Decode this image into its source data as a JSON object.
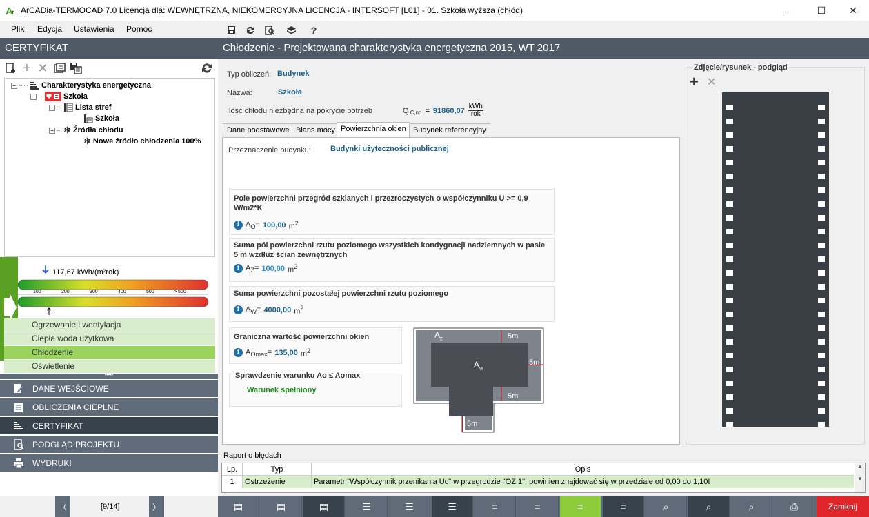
{
  "window": {
    "title": "ArCADia-TERMOCAD 7.0 Licencja dla: WEWNĘTRZNA, NIEKOMERCYJNA LICENCJA - INTERSOFT [L01] - 01. Szkoła wyższa (chłód)",
    "minimize": "—",
    "maximize": "☐",
    "close": "✕"
  },
  "menu": {
    "items": [
      {
        "label": "Plik"
      },
      {
        "label": "Edycja"
      },
      {
        "label": "Ustawienia"
      },
      {
        "label": "Pomoc"
      }
    ],
    "toolbar_icons": [
      "save-icon",
      "refresh-icon",
      "preview-icon",
      "layers-icon",
      "help-icon"
    ]
  },
  "left": {
    "header": "CERTYFIKAT",
    "tree": {
      "root": "Charakterystyka energetyczna",
      "building": "Szkoła",
      "zones": "Lista stref",
      "zone_item": "Szkoła",
      "sources": "Źródła chłodu",
      "source_item": "Nowe źródło chłodzenia 100%"
    },
    "energy": {
      "value_label": "117,67 kWh/(m²rok)",
      "ticks": [
        "100",
        "200",
        "300",
        "400",
        "500",
        "> 500"
      ]
    },
    "nav": [
      {
        "label": "Ogrzewanie i wentylacja"
      },
      {
        "label": "Ciepła woda użytkowa"
      },
      {
        "label": "Chłodzenie"
      },
      {
        "label": "Oświetlenie"
      }
    ],
    "dots": "•••••",
    "sections": [
      {
        "label": "DANE WEJŚCIOWE"
      },
      {
        "label": "OBLICZENIA CIEPLNE"
      },
      {
        "label": "CERTYFIKAT"
      },
      {
        "label": "PODGLĄD PROJEKTU"
      },
      {
        "label": "WYDRUKI"
      }
    ],
    "pager": {
      "text": "[9/14]",
      "prev": "〈",
      "next": "〉"
    }
  },
  "main": {
    "header": "Chłodzenie - Projektowana charakterystyka energetyczna 2015, WT 2017",
    "typ_label": "Typ obliczeń:",
    "typ_value": "Budynek",
    "nazwa_label": "Nazwa:",
    "nazwa_value": "Szkoła",
    "ilosc_label": "Ilość chłodu niezbędna na pokrycie potrzeb",
    "q_symbol": "Q",
    "q_sub": "C,nd",
    "q_eq": "=",
    "q_value": "91860,07",
    "q_unit_num": "kWh",
    "q_unit_den": "rok",
    "tabs": [
      {
        "label": "Dane podstawowe"
      },
      {
        "label": "Blans mocy"
      },
      {
        "label": "Powierzchnia okien"
      },
      {
        "label": "Budynek referencyjny"
      }
    ],
    "przeznaczenie_label": "Przeznaczenie budynku:",
    "przeznaczenie_value": "Budynki użyteczności publicznej",
    "box1": {
      "title": "Pole powierzchni przegród szklanych i przezroczystych o współczynniku U >= 0,9 W/m2*K",
      "sym": "A",
      "sub": "O",
      "value": "100,00",
      "unit": "m"
    },
    "box2": {
      "title": "Suma pól powierzchni rzutu poziomego wszystkich kondygnacji nadziemnych w pasie 5 m wzdłuż ścian zewnętrznych",
      "sym": "A",
      "sub": "Z",
      "value": "100,00",
      "unit": "m"
    },
    "box3": {
      "title": "Suma powierzchni pozostałej powierzchni rzutu poziomego",
      "sym": "A",
      "sub": "W",
      "value": "4000,00",
      "unit": "m"
    },
    "box4": {
      "title": "Graniczna wartość powierzchni okien",
      "sym": "A",
      "sub": "Omax",
      "value": "135,00",
      "unit": "m"
    },
    "box5": {
      "title": "Sprawdzenie warunku Ao ≤ Aomax",
      "result": "Warunek spełniony"
    },
    "diagram": {
      "az": "A",
      "az_sub": "z",
      "aw": "A",
      "aw_sub": "w",
      "d1": "5m",
      "d2": "5m",
      "d3": "5m",
      "d4": "5m"
    },
    "photo_title": "Zdjęcie/rysunek - podgląd",
    "report": {
      "title": "Raport o błędach",
      "headers": [
        "Lp.",
        "Typ",
        "Opis"
      ],
      "rows": [
        {
          "lp": "1",
          "typ": "Ostrzeżenie",
          "opis": "Parametr \"Współczynnik przenikania Uc\" w przegrodzie \"OZ 1\", powinien znajdować się w przedziale od 0,00 do 1,10!"
        }
      ]
    },
    "close_button": "Zamknij"
  },
  "colors": {
    "header_bg": "#505a66",
    "section_bg": "#5f6b78",
    "accent_green": "#5aa023",
    "value_blue": "#1a5f8a",
    "close_red": "#e0262a"
  }
}
